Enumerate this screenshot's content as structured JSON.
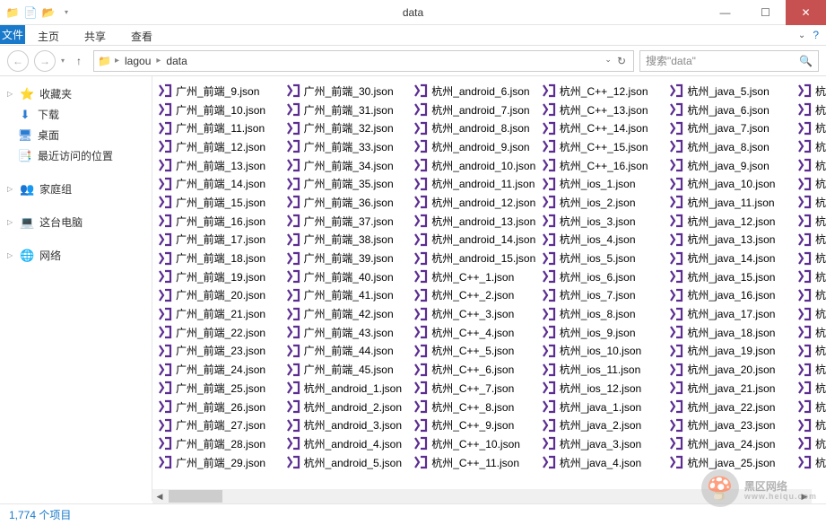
{
  "window": {
    "title": "data"
  },
  "ribbon": {
    "file": "文件",
    "tabs": [
      "主页",
      "共享",
      "查看"
    ]
  },
  "breadcrumb": {
    "parts": [
      "lagou",
      "data"
    ]
  },
  "search": {
    "placeholder": "搜索\"data\""
  },
  "nav": {
    "favorites": {
      "label": "收藏夹",
      "items": [
        "下载",
        "桌面",
        "最近访问的位置"
      ]
    },
    "homegroup": "家庭组",
    "thispc": "这台电脑",
    "network": "网络"
  },
  "status": {
    "text": "1,774 个项目"
  },
  "watermark": {
    "text": "黑区网络",
    "sub": "www.heiqu.com"
  },
  "columns": [
    [
      "广州_前端_9.json",
      "广州_前端_10.json",
      "广州_前端_11.json",
      "广州_前端_12.json",
      "广州_前端_13.json",
      "广州_前端_14.json",
      "广州_前端_15.json",
      "广州_前端_16.json",
      "广州_前端_17.json",
      "广州_前端_18.json",
      "广州_前端_19.json",
      "广州_前端_20.json",
      "广州_前端_21.json",
      "广州_前端_22.json",
      "广州_前端_23.json",
      "广州_前端_24.json",
      "广州_前端_25.json",
      "广州_前端_26.json",
      "广州_前端_27.json",
      "广州_前端_28.json",
      "广州_前端_29.json"
    ],
    [
      "广州_前端_30.json",
      "广州_前端_31.json",
      "广州_前端_32.json",
      "广州_前端_33.json",
      "广州_前端_34.json",
      "广州_前端_35.json",
      "广州_前端_36.json",
      "广州_前端_37.json",
      "广州_前端_38.json",
      "广州_前端_39.json",
      "广州_前端_40.json",
      "广州_前端_41.json",
      "广州_前端_42.json",
      "广州_前端_43.json",
      "广州_前端_44.json",
      "广州_前端_45.json",
      "杭州_android_1.json",
      "杭州_android_2.json",
      "杭州_android_3.json",
      "杭州_android_4.json",
      "杭州_android_5.json"
    ],
    [
      "杭州_android_6.json",
      "杭州_android_7.json",
      "杭州_android_8.json",
      "杭州_android_9.json",
      "杭州_android_10.json",
      "杭州_android_11.json",
      "杭州_android_12.json",
      "杭州_android_13.json",
      "杭州_android_14.json",
      "杭州_android_15.json",
      "杭州_C++_1.json",
      "杭州_C++_2.json",
      "杭州_C++_3.json",
      "杭州_C++_4.json",
      "杭州_C++_5.json",
      "杭州_C++_6.json",
      "杭州_C++_7.json",
      "杭州_C++_8.json",
      "杭州_C++_9.json",
      "杭州_C++_10.json",
      "杭州_C++_11.json"
    ],
    [
      "杭州_C++_12.json",
      "杭州_C++_13.json",
      "杭州_C++_14.json",
      "杭州_C++_15.json",
      "杭州_C++_16.json",
      "杭州_ios_1.json",
      "杭州_ios_2.json",
      "杭州_ios_3.json",
      "杭州_ios_4.json",
      "杭州_ios_5.json",
      "杭州_ios_6.json",
      "杭州_ios_7.json",
      "杭州_ios_8.json",
      "杭州_ios_9.json",
      "杭州_ios_10.json",
      "杭州_ios_11.json",
      "杭州_ios_12.json",
      "杭州_java_1.json",
      "杭州_java_2.json",
      "杭州_java_3.json",
      "杭州_java_4.json"
    ],
    [
      "杭州_java_5.json",
      "杭州_java_6.json",
      "杭州_java_7.json",
      "杭州_java_8.json",
      "杭州_java_9.json",
      "杭州_java_10.json",
      "杭州_java_11.json",
      "杭州_java_12.json",
      "杭州_java_13.json",
      "杭州_java_14.json",
      "杭州_java_15.json",
      "杭州_java_16.json",
      "杭州_java_17.json",
      "杭州_java_18.json",
      "杭州_java_19.json",
      "杭州_java_20.json",
      "杭州_java_21.json",
      "杭州_java_22.json",
      "杭州_java_23.json",
      "杭州_java_24.json",
      "杭州_java_25.json"
    ],
    [
      "杭",
      "杭",
      "杭",
      "杭",
      "杭",
      "杭",
      "杭",
      "杭",
      "杭",
      "杭",
      "杭",
      "杭",
      "杭",
      "杭",
      "杭",
      "杭",
      "杭",
      "杭",
      "杭",
      "杭",
      "杭"
    ]
  ]
}
